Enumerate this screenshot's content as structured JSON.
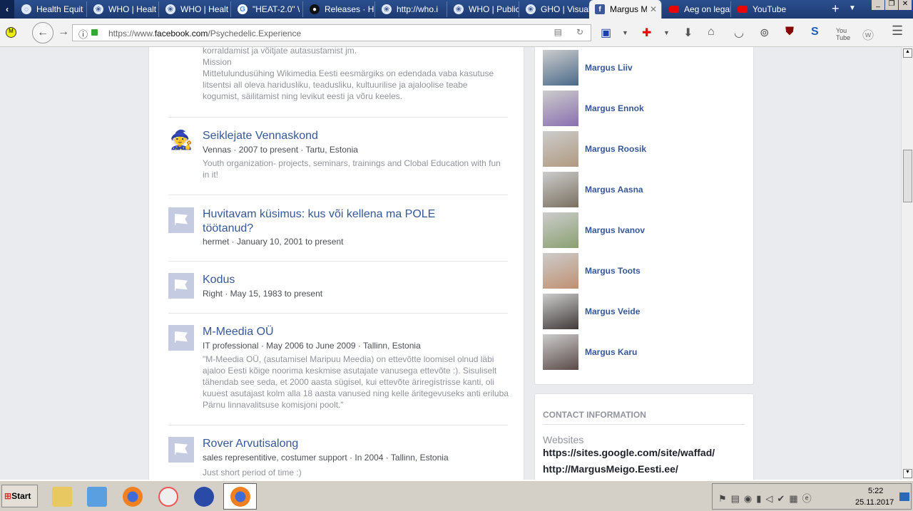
{
  "browser": {
    "tabs": [
      {
        "label": "Health Equit"
      },
      {
        "label": "WHO | Healt"
      },
      {
        "label": "WHO | Healt"
      },
      {
        "label": "\"HEAT-2.0\" \\"
      },
      {
        "label": "Releases · H"
      },
      {
        "label": "http://who.i"
      },
      {
        "label": "WHO | Public"
      },
      {
        "label": "GHO | Visual"
      },
      {
        "label": "Margus M"
      },
      {
        "label": "Aeg on legal"
      },
      {
        "label": "YouTube"
      }
    ],
    "url_prefix": "https://www.",
    "url_domain": "facebook.com",
    "url_path": "/Psychedelic.Experience"
  },
  "work": {
    "top_text_1": "korraldamist ja võitjate autasustamist jm.",
    "top_text_2": "Mission",
    "top_text_3": "Mittetulundusühing Wikimedia Eesti eesmärgiks on edendada vaba kasutuse litsentsi all oleva haridusliku, teadusliku, kultuurilise ja ajaloolise teabe kogumist, säilitamist ning levikut eesti ja võru keeles.",
    "entries": [
      {
        "title": "Seiklejate Vennaskond",
        "meta": "Vennas · 2007 to present · Tartu, Estonia",
        "desc": "Youth organization- projects, seminars, trainings and Clobal Education with fun in it!"
      },
      {
        "title": "Huvitavam küsimus: kus või kellena ma POLE töötanud?",
        "meta": "hermet · January 10, 2001 to present",
        "desc": ""
      },
      {
        "title": "Kodus",
        "meta": "Right · May 15, 1983 to present",
        "desc": ""
      },
      {
        "title": "M-Meedia OÜ",
        "meta": "IT professional · May 2006 to June 2009 · Tallinn, Estonia",
        "desc": "\"M-Meedia OÜ, (asutamisel Maripuu Meedia) on ettevõtte loomisel olnud läbi ajaloo Eesti kõige noorima keskmise asutajate vanusega ettevõte :). Sisuliselt tähendab see seda, et 2000 aasta sügisel, kui ettevõte äriregistrisse kanti, oli kuuest asutajast kolm alla 18 aasta vanused ning kelle äritegevuseks anti eriluba Pärnu linnavalitsuse komisjoni poolt.\""
      },
      {
        "title": "Rover Arvutisalong",
        "meta": "sales representitive, costumer support · In 2004 · Tallinn, Estonia",
        "desc": "Just short period of time :)"
      }
    ]
  },
  "friends": [
    {
      "name": "Margus Liiv",
      "color": "#4a6a8a"
    },
    {
      "name": "Margus Ennok",
      "color": "#8a6fb0"
    },
    {
      "name": "Margus Roosik",
      "color": "#b09a80"
    },
    {
      "name": "Margus Aasna",
      "color": "#7a7060"
    },
    {
      "name": "Margus Ivanov",
      "color": "#8aa070"
    },
    {
      "name": "Margus Toots",
      "color": "#c09070"
    },
    {
      "name": "Margus Veide",
      "color": "#403a38"
    },
    {
      "name": "Margus Karu",
      "color": "#5a4a48"
    }
  ],
  "contact": {
    "heading": "CONTACT INFORMATION",
    "websites_label": "Websites",
    "websites": [
      "https://sites.google.com/site/waffad/",
      "http://MargusMeigo.Eesti.ee/"
    ]
  },
  "taskbar": {
    "start": "Start",
    "time": "5:22",
    "date": "25.11.2017"
  }
}
